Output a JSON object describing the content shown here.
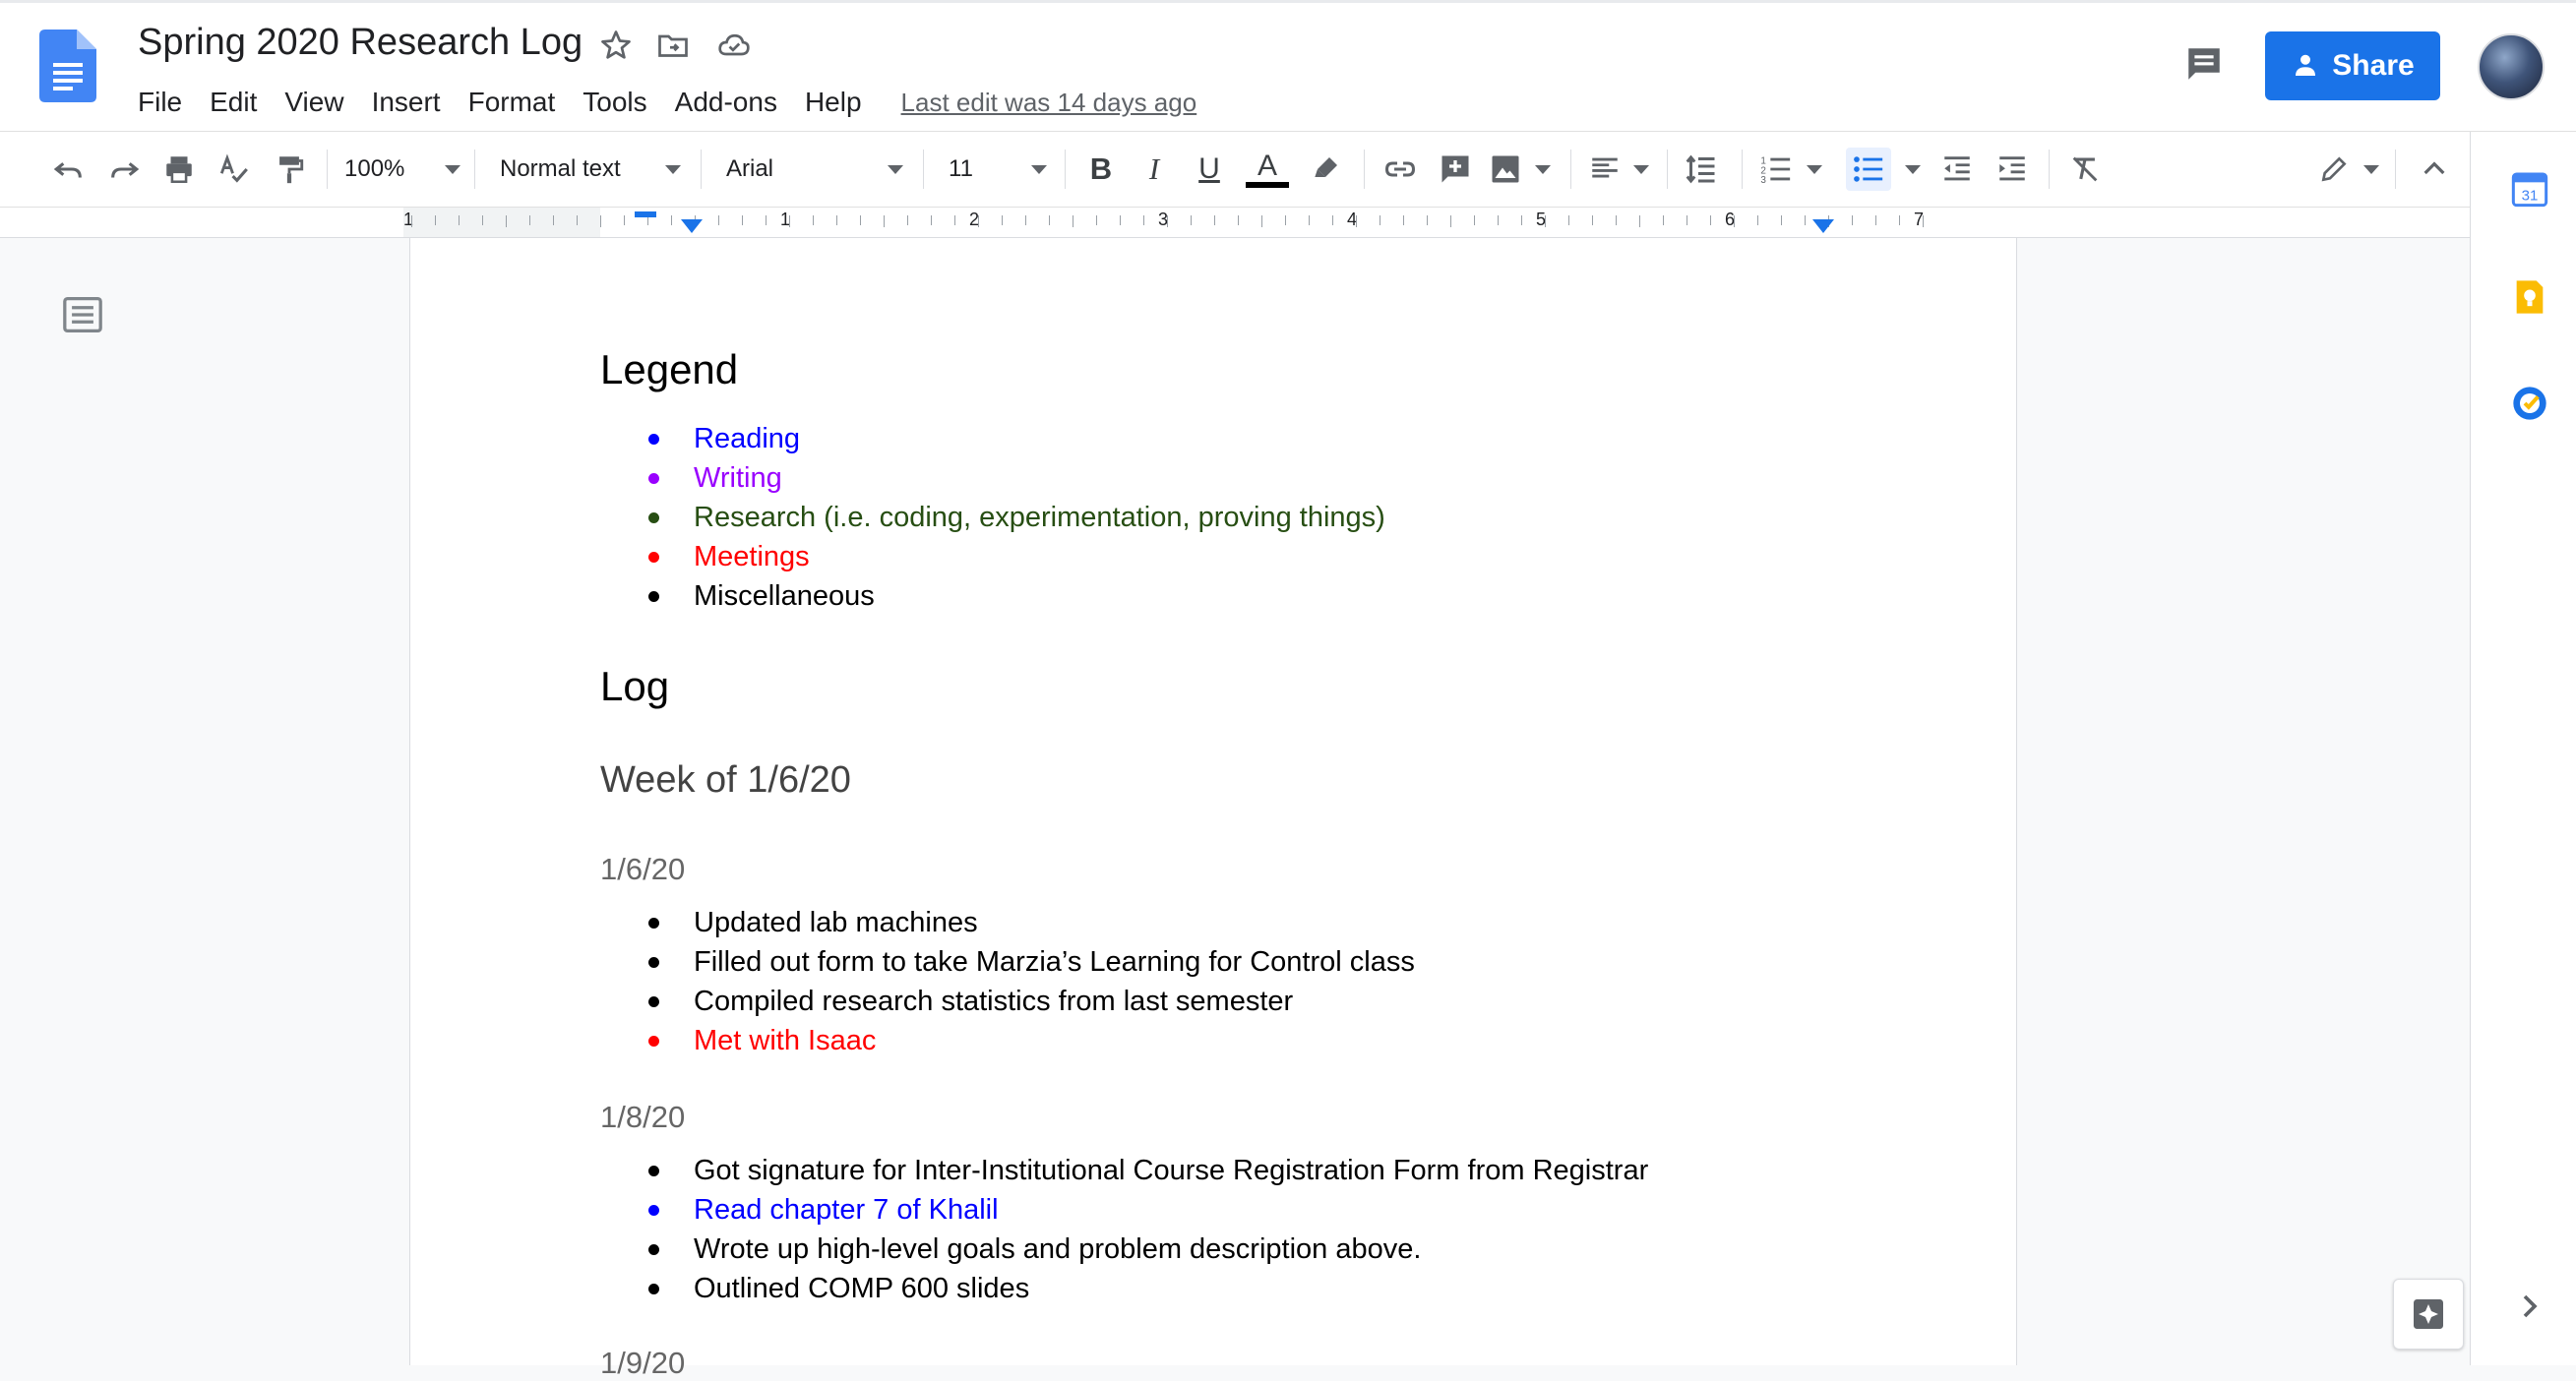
{
  "doc": {
    "title": "Spring 2020 Research Log",
    "last_edit": "Last edit was 14 days ago"
  },
  "menu": [
    "File",
    "Edit",
    "View",
    "Insert",
    "Format",
    "Tools",
    "Add-ons",
    "Help"
  ],
  "header": {
    "share_label": "Share"
  },
  "toolbar": {
    "zoom": "100%",
    "style": "Normal text",
    "font": "Arial",
    "size": "11",
    "bold": "B",
    "italic": "I",
    "underline": "U",
    "text_color": "A"
  },
  "ruler": {
    "labels": [
      "1",
      "1",
      "2",
      "3",
      "4",
      "5",
      "6",
      "7"
    ]
  },
  "colors": {
    "reading": "#0000ff",
    "writing": "#9900ff",
    "research": "#274e13",
    "meetings": "#ff0000",
    "misc": "#000000",
    "accent": "#1a73e8"
  },
  "legend": {
    "heading": "Legend",
    "items": [
      {
        "label": "Reading",
        "category": "reading"
      },
      {
        "label": "Writing",
        "category": "writing"
      },
      {
        "label": "Research (i.e. coding, experimentation, proving things)",
        "category": "research"
      },
      {
        "label": "Meetings",
        "category": "meetings"
      },
      {
        "label": "Miscellaneous",
        "category": "misc"
      }
    ]
  },
  "log": {
    "heading": "Log",
    "week": "Week of 1/6/20",
    "days": [
      {
        "date": "1/6/20",
        "items": [
          {
            "text": "Updated lab machines",
            "category": "misc"
          },
          {
            "text": "Filled out form to take Marzia’s Learning for Control class",
            "category": "misc"
          },
          {
            "text": "Compiled research statistics from last semester",
            "category": "misc"
          },
          {
            "text": "Met with Isaac",
            "category": "meetings"
          }
        ]
      },
      {
        "date": "1/8/20",
        "items": [
          {
            "text": "Got signature for Inter-Institutional Course Registration Form from Registrar",
            "category": "misc"
          },
          {
            "text": "Read chapter 7 of Khalil",
            "category": "reading"
          },
          {
            "text": "Wrote up high-level goals and problem description above.",
            "category": "misc"
          },
          {
            "text": "Outlined COMP 600 slides",
            "category": "misc"
          }
        ]
      }
    ],
    "next_date_partial": "1/9/20"
  },
  "icons": {
    "docs": "docs-logo-icon",
    "star": "star-icon",
    "move": "move-to-folder-icon",
    "cloud": "cloud-status-icon",
    "comments": "comments-icon",
    "outline": "document-outline-icon",
    "calendar": "calendar-icon",
    "keep": "keep-icon",
    "tasks": "tasks-icon",
    "explore": "explore-icon",
    "expand": "chevron-right-icon"
  },
  "side_panel": {
    "calendar_day": "31"
  }
}
